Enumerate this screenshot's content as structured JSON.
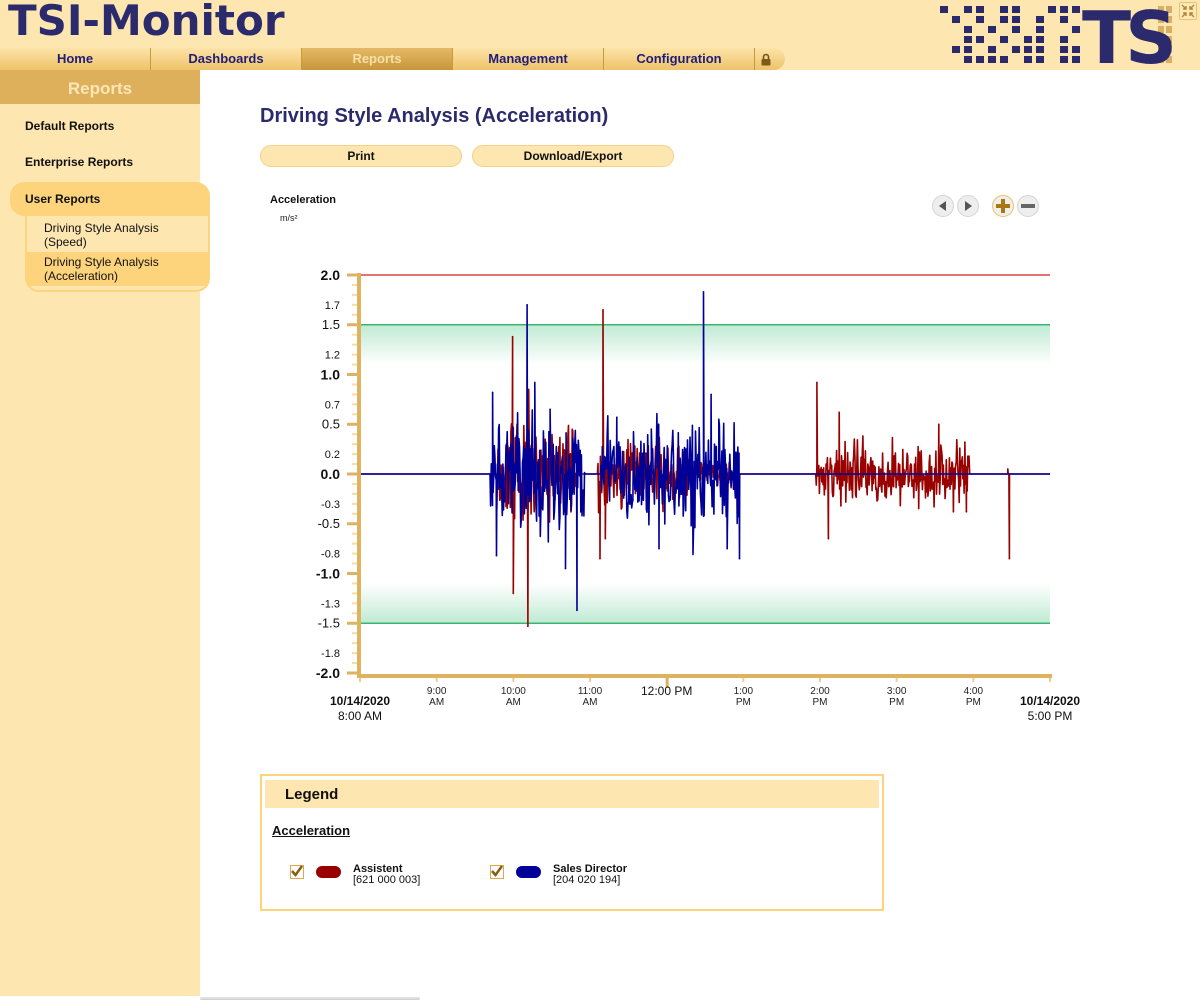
{
  "app": {
    "title": "TSI-Monitor",
    "logo_text": "TSI"
  },
  "nav": {
    "items": [
      {
        "label": "Home",
        "active": false
      },
      {
        "label": "Dashboards",
        "active": false
      },
      {
        "label": "Reports",
        "active": true
      },
      {
        "label": "Management",
        "active": false
      },
      {
        "label": "Configuration",
        "active": false
      }
    ],
    "lock_icon": "lock-icon"
  },
  "sidebar": {
    "header": "Reports",
    "links": [
      "Default Reports",
      "Enterprise Reports"
    ],
    "group": {
      "label": "User Reports",
      "items": [
        {
          "line1": "Driving Style Analysis",
          "line2": "(Speed)",
          "active": false
        },
        {
          "line1": "Driving Style Analysis",
          "line2": "(Acceleration)",
          "active": true
        }
      ]
    }
  },
  "main": {
    "title": "Driving Style Analysis (Acceleration)",
    "buttons": {
      "print": "Print",
      "export": "Download/Export"
    },
    "chart_label": "Acceleration",
    "chart_unit": "m/s²",
    "controls": [
      "prev-icon",
      "next-icon",
      "zoom-in-icon",
      "zoom-out-icon"
    ]
  },
  "chart_data": {
    "type": "line",
    "title": "Acceleration",
    "ylabel": "m/s²",
    "xlabel": "",
    "ylim": [
      -2.0,
      2.0
    ],
    "xlim_hours": [
      8,
      17
    ],
    "y_ticks": [
      {
        "v": 2.0,
        "label": "2.0",
        "major": true
      },
      {
        "v": 1.7,
        "label": "1.7",
        "major": false
      },
      {
        "v": 1.5,
        "label": "1.5",
        "major": "mid"
      },
      {
        "v": 1.2,
        "label": "1.2",
        "major": false
      },
      {
        "v": 1.0,
        "label": "1.0",
        "major": true
      },
      {
        "v": 0.7,
        "label": "0.7",
        "major": false
      },
      {
        "v": 0.5,
        "label": "0.5",
        "major": "mid"
      },
      {
        "v": 0.2,
        "label": "0.2",
        "major": false
      },
      {
        "v": 0.0,
        "label": "0.0",
        "major": true
      },
      {
        "v": -0.3,
        "label": "-0.3",
        "major": false
      },
      {
        "v": -0.5,
        "label": "-0.5",
        "major": "mid"
      },
      {
        "v": -0.8,
        "label": "-0.8",
        "major": false
      },
      {
        "v": -1.0,
        "label": "-1.0",
        "major": true
      },
      {
        "v": -1.3,
        "label": "-1.3",
        "major": false
      },
      {
        "v": -1.5,
        "label": "-1.5",
        "major": "mid"
      },
      {
        "v": -1.8,
        "label": "-1.8",
        "major": false
      },
      {
        "v": -2.0,
        "label": "-2.0",
        "major": true
      }
    ],
    "x_ticks": [
      {
        "h": 8,
        "label1": "10/14/2020",
        "label2": "8:00 AM",
        "kind": "edge"
      },
      {
        "h": 9,
        "label1": "9:00",
        "label2": "AM",
        "kind": "minor"
      },
      {
        "h": 10,
        "label1": "10:00",
        "label2": "AM",
        "kind": "minor"
      },
      {
        "h": 11,
        "label1": "11:00",
        "label2": "AM",
        "kind": "minor"
      },
      {
        "h": 12,
        "label1": "12:00 PM",
        "label2": "",
        "kind": "noon"
      },
      {
        "h": 13,
        "label1": "1:00",
        "label2": "PM",
        "kind": "minor"
      },
      {
        "h": 14,
        "label1": "2:00",
        "label2": "PM",
        "kind": "minor"
      },
      {
        "h": 15,
        "label1": "3:00",
        "label2": "PM",
        "kind": "minor"
      },
      {
        "h": 16,
        "label1": "4:00",
        "label2": "PM",
        "kind": "minor"
      },
      {
        "h": 17,
        "label1": "10/14/2020",
        "label2": "5:00 PM",
        "kind": "edge"
      }
    ],
    "limit_lines": [
      {
        "name": "max-limit",
        "value": 2.0,
        "color": "#d42020"
      },
      {
        "name": "upper-threshold",
        "value": 1.5,
        "color": "#1ea85a"
      },
      {
        "name": "lower-threshold",
        "value": -1.5,
        "color": "#1ea85a"
      }
    ],
    "threshold_band_color": "#c3ecd6",
    "series": [
      {
        "name": "Assistent",
        "id": "[621 000 003]",
        "color": "#990000",
        "bursts": [
          {
            "start": 9.78,
            "end": 10.82,
            "amp": 0.45
          },
          {
            "start": 11.1,
            "end": 12.3,
            "amp": 0.35
          },
          {
            "start": 12.3,
            "end": 12.85,
            "amp": 0.12
          },
          {
            "start": 13.95,
            "end": 15.95,
            "amp": 0.3
          }
        ],
        "spikes": [
          {
            "h": 9.99,
            "v": 1.38
          },
          {
            "h": 10.0,
            "v": -1.2
          },
          {
            "h": 10.2,
            "v": 0.85
          },
          {
            "h": 10.19,
            "v": -1.53
          },
          {
            "h": 11.13,
            "v": -0.85
          },
          {
            "h": 11.17,
            "v": 1.65
          },
          {
            "h": 11.2,
            "v": -0.65
          },
          {
            "h": 13.96,
            "v": 0.92
          },
          {
            "h": 14.11,
            "v": -0.65
          },
          {
            "h": 14.25,
            "v": 0.62
          },
          {
            "h": 15.55,
            "v": 0.5
          },
          {
            "h": 15.74,
            "v": -0.38
          },
          {
            "h": 15.89,
            "v": 0.32
          },
          {
            "h": 15.91,
            "v": -0.38
          },
          {
            "h": 16.45,
            "v": 0.05
          },
          {
            "h": 16.47,
            "v": -0.85
          }
        ]
      },
      {
        "name": "Sales Director",
        "id": "[204 020 194]",
        "color": "#000099",
        "bursts": [
          {
            "start": 9.7,
            "end": 10.93,
            "amp": 0.55
          },
          {
            "start": 11.14,
            "end": 12.5,
            "amp": 0.5
          },
          {
            "start": 12.3,
            "end": 12.95,
            "amp": 0.45
          }
        ],
        "spikes": [
          {
            "h": 9.73,
            "v": 0.82
          },
          {
            "h": 9.78,
            "v": -0.82
          },
          {
            "h": 10.18,
            "v": 1.7
          },
          {
            "h": 10.28,
            "v": 0.92
          },
          {
            "h": 10.48,
            "v": 0.65
          },
          {
            "h": 10.68,
            "v": -0.95
          },
          {
            "h": 10.83,
            "v": -1.37
          },
          {
            "h": 11.35,
            "v": 0.57
          },
          {
            "h": 11.8,
            "v": 0.45
          },
          {
            "h": 11.9,
            "v": -0.75
          },
          {
            "h": 12.48,
            "v": 1.83
          },
          {
            "h": 12.58,
            "v": 0.8
          },
          {
            "h": 12.68,
            "v": 0.55
          },
          {
            "h": 12.79,
            "v": -0.75
          },
          {
            "h": 12.93,
            "v": 0.2
          },
          {
            "h": 12.95,
            "v": -0.85
          }
        ]
      }
    ],
    "legend": "bottom"
  },
  "legend": {
    "header": "Legend",
    "group": "Acceleration",
    "entries": [
      {
        "name": "Assistent",
        "id": "[621 000 003]",
        "color": "#990000",
        "checked": true
      },
      {
        "name": "Sales Director",
        "id": "[204 020 194]",
        "color": "#000099",
        "checked": true
      }
    ]
  }
}
